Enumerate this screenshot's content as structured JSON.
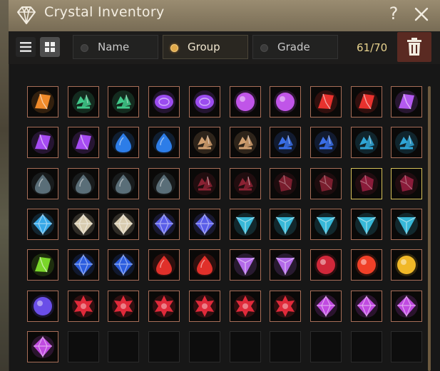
{
  "window": {
    "title": "Crystal Inventory",
    "help": "?"
  },
  "toolbar": {
    "sort_tabs": [
      {
        "label": "Name",
        "selected": false
      },
      {
        "label": "Group",
        "selected": true
      },
      {
        "label": "Grade",
        "selected": false
      }
    ],
    "count": "61/70"
  },
  "inventory": {
    "capacity": 70,
    "filled": 61,
    "items": [
      {
        "shape": "shard",
        "color": "#f08a2a"
      },
      {
        "shape": "cluster",
        "color": "#40c98a"
      },
      {
        "shape": "cluster",
        "color": "#40c98a"
      },
      {
        "shape": "oval",
        "color": "#9b4cf0"
      },
      {
        "shape": "oval",
        "color": "#9b4cf0"
      },
      {
        "shape": "orb",
        "color": "#c055e8"
      },
      {
        "shape": "orb",
        "color": "#c055e8"
      },
      {
        "shape": "shard",
        "color": "#e8322e"
      },
      {
        "shape": "shard",
        "color": "#e8322e"
      },
      {
        "shape": "shard",
        "color": "#b45af0"
      },
      {
        "shape": "shard",
        "color": "#a64bf2"
      },
      {
        "shape": "shard",
        "color": "#a64bf2"
      },
      {
        "shape": "drop",
        "color": "#2d7de8"
      },
      {
        "shape": "drop",
        "color": "#2d7de8"
      },
      {
        "shape": "cluster",
        "color": "#d2a070"
      },
      {
        "shape": "cluster",
        "color": "#d2a070"
      },
      {
        "shape": "cluster",
        "color": "#3a6fe8"
      },
      {
        "shape": "cluster",
        "color": "#3a6fe8"
      },
      {
        "shape": "cluster",
        "color": "#2fa6d8"
      },
      {
        "shape": "cluster",
        "color": "#2fa6d8"
      },
      {
        "shape": "drop",
        "color": "#5a6e78"
      },
      {
        "shape": "drop",
        "color": "#5a6e78"
      },
      {
        "shape": "drop",
        "color": "#5a6e78"
      },
      {
        "shape": "drop",
        "color": "#5a6e78"
      },
      {
        "shape": "cluster",
        "color": "#8a2233"
      },
      {
        "shape": "cluster",
        "color": "#8a2233"
      },
      {
        "shape": "gem",
        "color": "#7a1e2e"
      },
      {
        "shape": "gem",
        "color": "#7a1e2e"
      },
      {
        "shape": "gem",
        "color": "#8a1c3a",
        "gold": true
      },
      {
        "shape": "gem",
        "color": "#8a1c3a",
        "gold": true
      },
      {
        "shape": "diamond",
        "color": "#38a8e8"
      },
      {
        "shape": "diamond",
        "color": "#d8ccb0"
      },
      {
        "shape": "diamond",
        "color": "#d8ccb0"
      },
      {
        "shape": "diamond",
        "color": "#5a5ee8"
      },
      {
        "shape": "diamond",
        "color": "#5a5ee8"
      },
      {
        "shape": "tri",
        "color": "#38b8d8"
      },
      {
        "shape": "tri",
        "color": "#38b8d8"
      },
      {
        "shape": "tri",
        "color": "#38b8d8"
      },
      {
        "shape": "tri",
        "color": "#38b8d8"
      },
      {
        "shape": "tri",
        "color": "#38b8d8"
      },
      {
        "shape": "shard",
        "color": "#7ad62a"
      },
      {
        "shape": "diamond",
        "color": "#2d5ee0"
      },
      {
        "shape": "diamond",
        "color": "#2d5ee0"
      },
      {
        "shape": "drop",
        "color": "#e0302a"
      },
      {
        "shape": "drop",
        "color": "#e0302a"
      },
      {
        "shape": "tri",
        "color": "#b36ae8"
      },
      {
        "shape": "tri",
        "color": "#b36ae8"
      },
      {
        "shape": "orb",
        "color": "#d0283a"
      },
      {
        "shape": "orb",
        "color": "#f04028"
      },
      {
        "shape": "orb",
        "color": "#f0b828"
      },
      {
        "shape": "orb",
        "color": "#6a4ee8"
      },
      {
        "shape": "star",
        "color": "#e02a3a"
      },
      {
        "shape": "star",
        "color": "#e02a3a"
      },
      {
        "shape": "star",
        "color": "#e02a3a"
      },
      {
        "shape": "star",
        "color": "#e02a3a"
      },
      {
        "shape": "star",
        "color": "#e02a3a"
      },
      {
        "shape": "star",
        "color": "#e02a3a"
      },
      {
        "shape": "diamond",
        "color": "#c04ae0"
      },
      {
        "shape": "diamond",
        "color": "#c04ae0"
      },
      {
        "shape": "diamond",
        "color": "#c04ae0"
      },
      {
        "shape": "diamond",
        "color": "#c04ae0"
      }
    ]
  },
  "colors": {
    "titlebar": "#877a61",
    "trash_bg": "#5a2a22",
    "slot_border": "#a86e58",
    "count_text": "#e8d38e",
    "selected_dot": "#e0a84a"
  }
}
